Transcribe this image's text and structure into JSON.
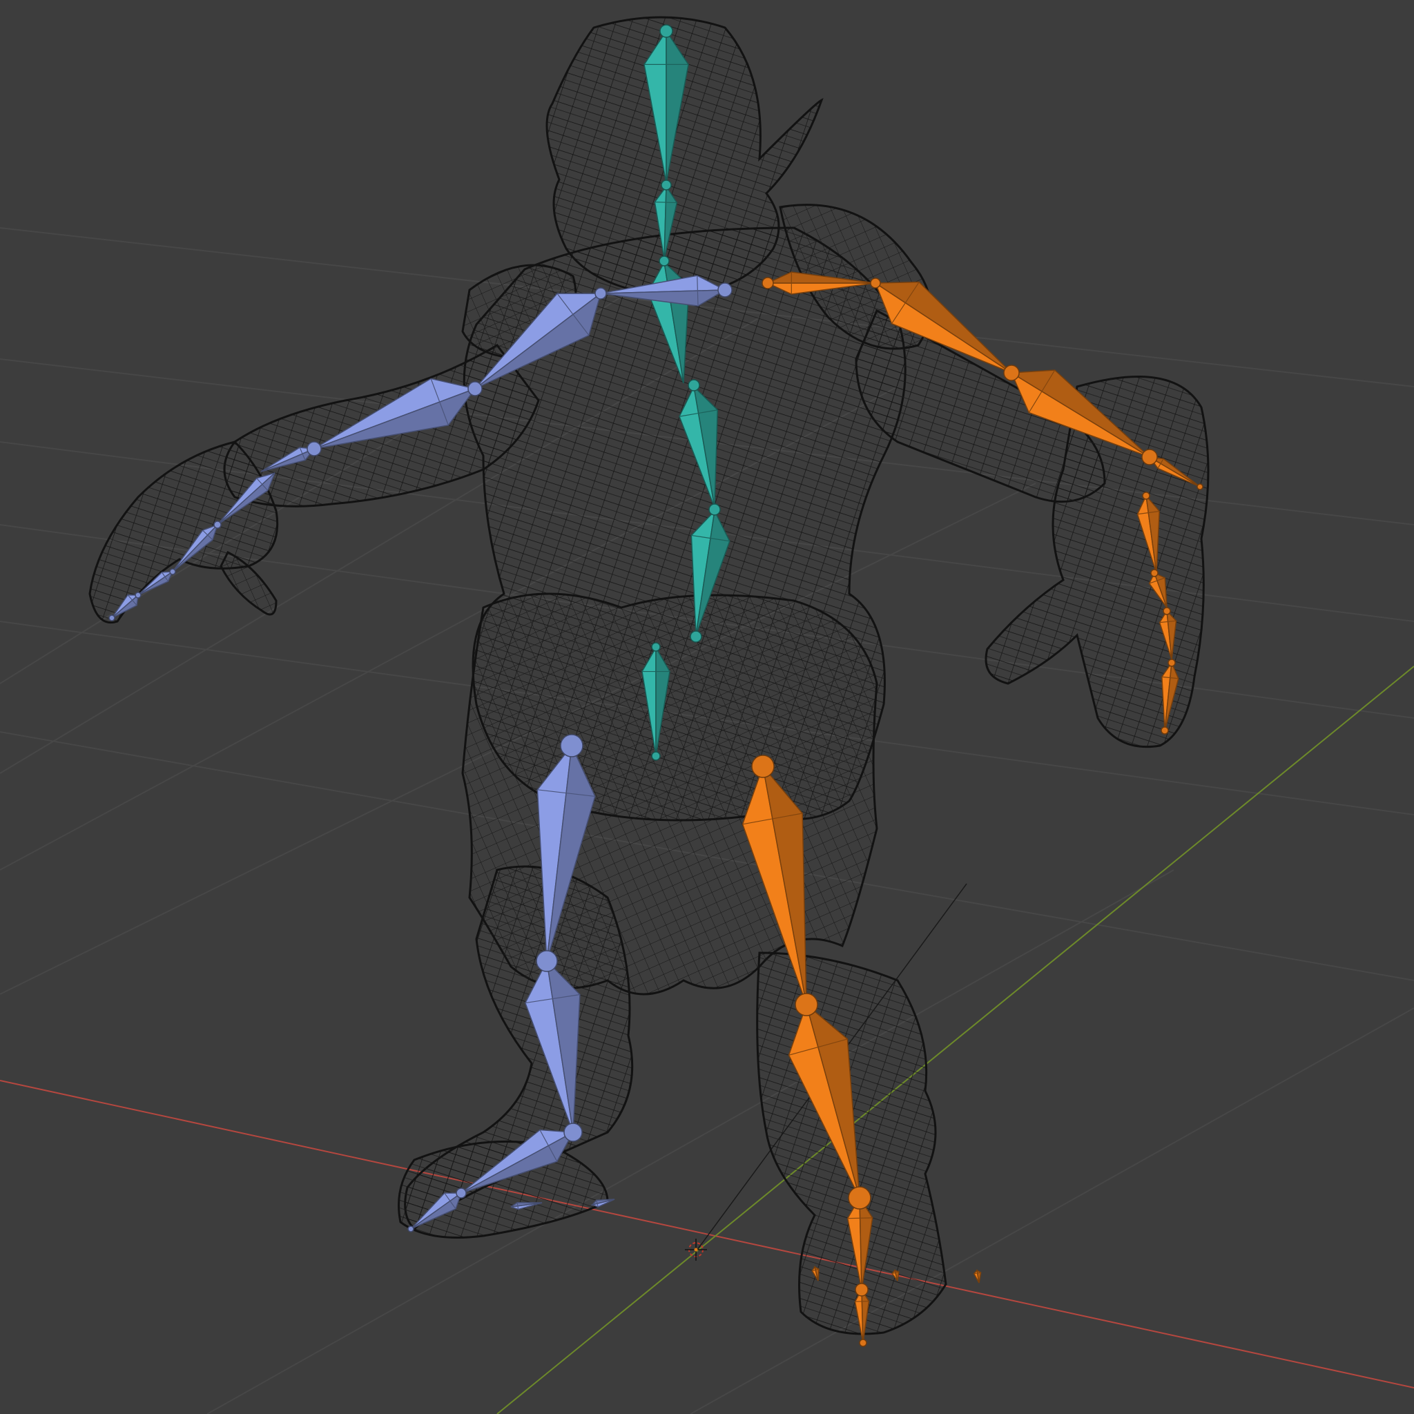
{
  "viewport": {
    "background": "#3d3d3d",
    "grid_color": "#4a4a4a",
    "axis_x_color": "#b5473f",
    "axis_y_color": "#6d8a2a",
    "wire_color": "#141414"
  },
  "armature": {
    "spine_color": "#2fa59a",
    "left_color": "#7f8fd0",
    "right_color": "#dc7418"
  },
  "cursor_icon": "3d-cursor-icon"
}
